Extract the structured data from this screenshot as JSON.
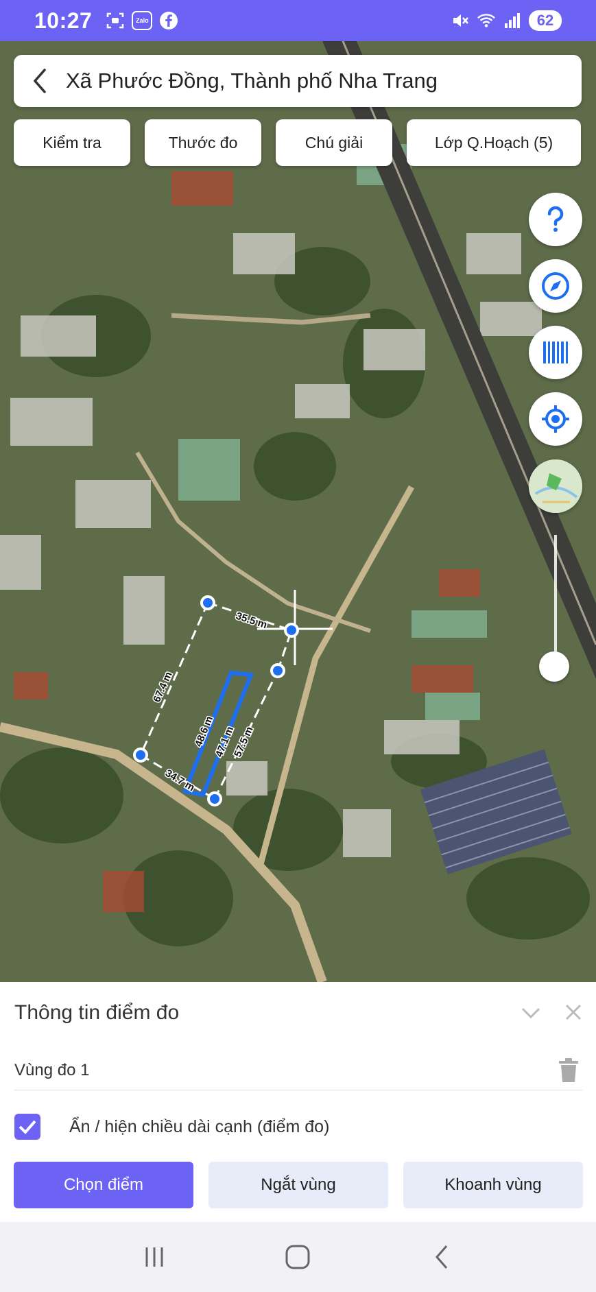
{
  "status_bar": {
    "time": "10:27",
    "zalo_label": "Zalo",
    "battery": "62",
    "icons": [
      "screenshot-icon",
      "zalo-icon",
      "facebook-icon",
      "mute-icon",
      "wifi-icon",
      "signal-icon",
      "battery-icon"
    ]
  },
  "header": {
    "location_title": "Xã Phước Đồng, Thành phố Nha Trang",
    "back_icon": "chevron-left-icon"
  },
  "toolbar": {
    "chips": [
      "Kiểm tra",
      "Thước đo",
      "Chú giải",
      "Lớp Q.Hoạch (5)"
    ]
  },
  "map_controls": {
    "icons": [
      "help-icon",
      "compass-icon",
      "barcode-icon",
      "locate-icon",
      "basemap-thumbnail"
    ]
  },
  "measurement": {
    "outer_edges": [
      "35.5 m",
      "67.4 m",
      "34.7 m",
      "57.5 m"
    ],
    "inner_edges": [
      "48.6 m",
      "47.1 m"
    ]
  },
  "sheet": {
    "title": "Thông tin điểm đo",
    "region_name": "Vùng đo 1",
    "toggle_label": "Ẩn / hiện chiều dài cạnh (điểm đo)",
    "toggle_checked": true,
    "buttons": {
      "select_point": "Chọn điểm",
      "break_region": "Ngắt vùng",
      "enclose_region": "Khoanh vùng"
    }
  },
  "colors": {
    "accent": "#6c63f5",
    "measure_blue": "#1d6ff0"
  }
}
